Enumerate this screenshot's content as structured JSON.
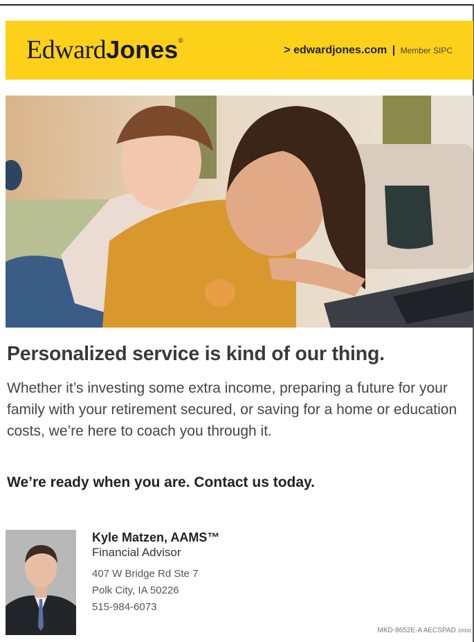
{
  "banner": {
    "logo_regular": "Edward",
    "logo_bold": "Jones",
    "logo_mark": "®",
    "link_prefix": "> ",
    "link_url": "edwardjones.com",
    "separator": "|",
    "member": "Member SIPC",
    "color": "#fdd11a"
  },
  "headline": "Personalized service is kind of our thing.",
  "body": "Whether it’s investing some extra income, preparing a future for your family with your retirement secured, or saving for a home or education costs, we’re here to coach you through it.",
  "cta": "We’re ready when you are. Contact us today.",
  "advisor": {
    "name": "Kyle Matzen, AAMS™",
    "title": "Financial Advisor",
    "address_line1": "407 W Bridge Rd Ste 7",
    "address_line2": "Polk City, IA 50226",
    "phone": "515-984-6073"
  },
  "footer": {
    "code": "MKD-8652E-A AECSPAD",
    "code_suffix": "20000"
  }
}
